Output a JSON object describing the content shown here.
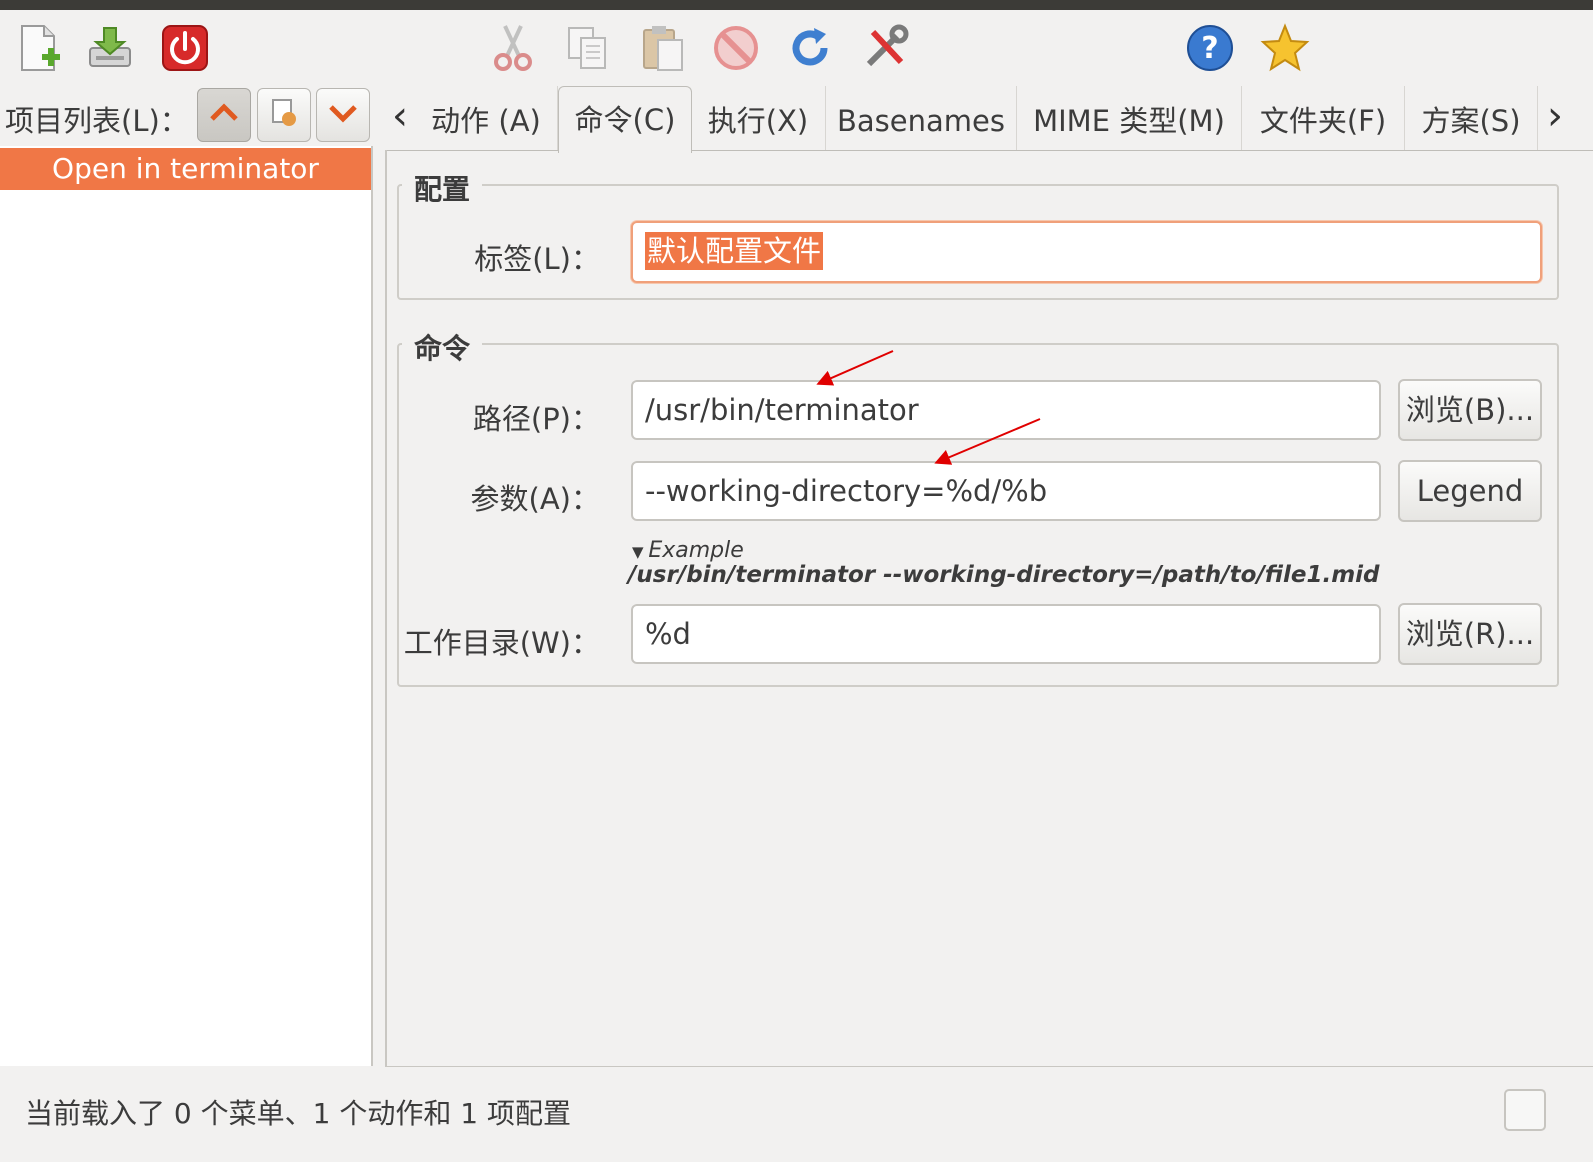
{
  "window": {
    "title": ""
  },
  "toolbar": {
    "items": [
      {
        "name": "new-document-icon"
      },
      {
        "name": "save-icon"
      },
      {
        "name": "quit-icon"
      },
      {
        "name": "cut-icon"
      },
      {
        "name": "copy-icon"
      },
      {
        "name": "paste-icon"
      },
      {
        "name": "delete-icon"
      },
      {
        "name": "reload-icon"
      },
      {
        "name": "preferences-icon"
      },
      {
        "name": "help-icon"
      },
      {
        "name": "about-icon"
      }
    ]
  },
  "items_list": {
    "label": "项目列表(L)：",
    "items": [
      {
        "label": "Open in terminator",
        "selected": true
      }
    ]
  },
  "tabs": [
    {
      "label": "动作 (A)"
    },
    {
      "label": "命令(C)",
      "active": true
    },
    {
      "label": "执行(X)"
    },
    {
      "label": "Basenames"
    },
    {
      "label": "MIME 类型(M)"
    },
    {
      "label": "文件夹(F)"
    },
    {
      "label": "方案(S)"
    }
  ],
  "profile": {
    "title": "配置",
    "label_label": "标签(L)：",
    "label_value": "默认配置文件"
  },
  "command": {
    "title": "命令",
    "path_label": "路径(P)：",
    "path_value": "/usr/bin/terminator",
    "browse_path": "浏览(B)...",
    "params_label": "参数(A)：",
    "params_value": "--working-directory=%d/%b",
    "legend": "Legend",
    "example_toggle": "Example",
    "example_text": "/usr/bin/terminator --working-directory=/path/to/file1.mid",
    "workdir_label": "工作目录(W)：",
    "workdir_value": "%d",
    "browse_workdir": "浏览(R)..."
  },
  "status": {
    "text": "当前载入了 0 个菜单、1 个动作和 1 项配置"
  },
  "colors": {
    "accent": "#f07746",
    "annotation": "#e00000"
  }
}
